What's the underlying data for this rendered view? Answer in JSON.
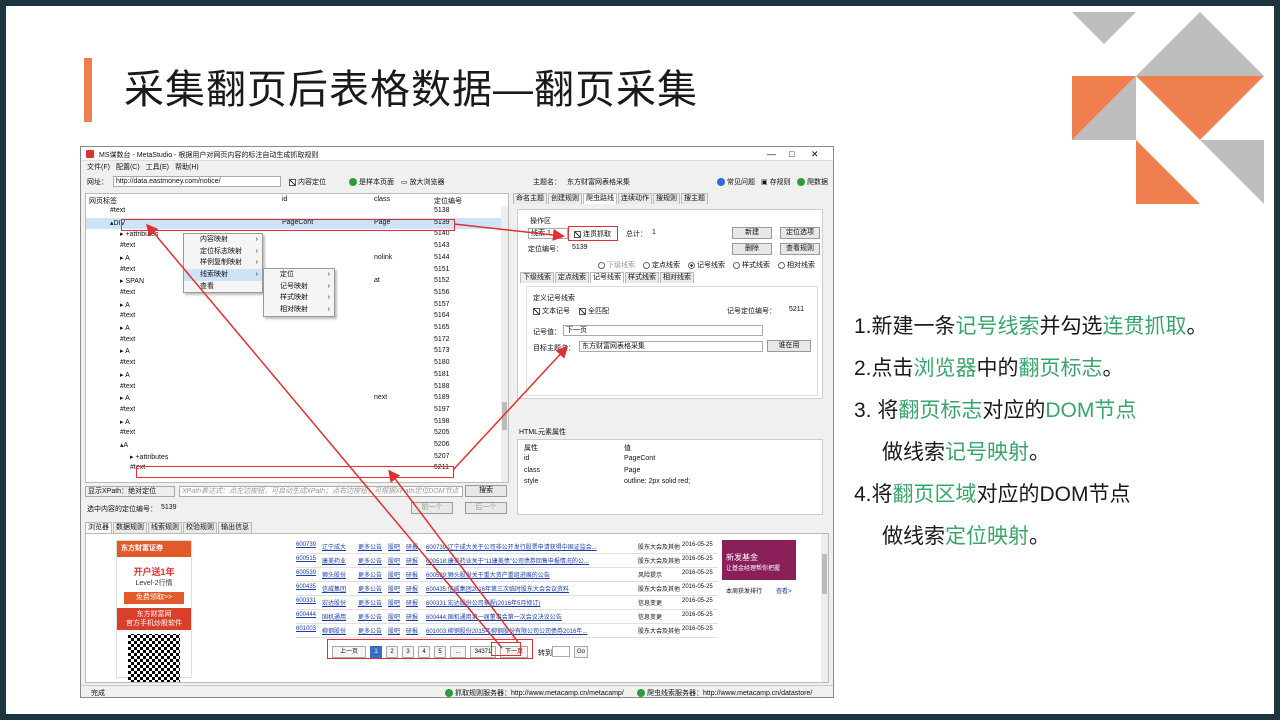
{
  "slide": {
    "title": "采集翻页后表格数据—翻页采集",
    "accent_color": "#ef7f4f",
    "highlight_color": "#3aa56b"
  },
  "notes": [
    [
      {
        "t": "1.新建一条"
      },
      {
        "t": "记号线索",
        "hl": true
      },
      {
        "t": "并勾选"
      },
      {
        "t": "连贯抓取",
        "hl": true
      },
      {
        "t": "。"
      }
    ],
    [
      {
        "t": "2.点击"
      },
      {
        "t": "浏览器",
        "hl": true
      },
      {
        "t": "中的"
      },
      {
        "t": "翻页标志",
        "hl": true
      },
      {
        "t": "。"
      }
    ],
    [
      {
        "t": "3. 将"
      },
      {
        "t": "翻页标志",
        "hl": true
      },
      {
        "t": "对应的"
      },
      {
        "t": "DOM节点",
        "hl": true
      }
    ],
    [
      {
        "t": "做线索"
      },
      {
        "t": "记号映射",
        "hl": true
      },
      {
        "t": "。"
      }
    ],
    [
      {
        "t": "4.将"
      },
      {
        "t": "翻页区域",
        "hl": true
      },
      {
        "t": "对应的DOM节点"
      }
    ],
    [
      {
        "t": "做线索"
      },
      {
        "t": "定位映射",
        "hl": true
      },
      {
        "t": "。"
      }
    ]
  ],
  "window": {
    "title": "MS谋数台 - MetaStudio - 根据用户对网页内容的标注自动生成抓取规则",
    "menu": [
      "文件(F)",
      "配置(C)",
      "工具(E)",
      "帮助(H)"
    ],
    "address_label": "网址：",
    "address_value": "http://data.eastmoney.com/notice/",
    "content_locate": "内容定位",
    "btn_sample": "是样本页面",
    "btn_zoom": "放大浏览器",
    "topic_label": "主题名：",
    "topic_value": "东方财富网表格采集",
    "faq": "常见问题",
    "save_rule": "存规则",
    "crawl_data": "爬数据",
    "tree_headers": [
      "网页标签",
      "id",
      "class",
      "定位编号"
    ],
    "tree_rows": [
      {
        "tag": "#text",
        "id": "",
        "cls": "",
        "num": "5138",
        "indent": 2
      },
      {
        "tag": "▴DIV",
        "id": "PageCont",
        "cls": "Page",
        "num": "5139",
        "indent": 2,
        "sel": true
      },
      {
        "tag": "▸ +attributes",
        "id": "",
        "cls": "",
        "num": "5140",
        "indent": 3
      },
      {
        "tag": "#text",
        "id": "",
        "cls": "",
        "num": "5143",
        "indent": 3
      },
      {
        "tag": "▸ A",
        "id": "",
        "cls": "nolink",
        "num": "5144",
        "indent": 3
      },
      {
        "tag": "#text",
        "id": "",
        "cls": "",
        "num": "5151",
        "indent": 3
      },
      {
        "tag": "▸ SPAN",
        "id": "",
        "cls": "at",
        "num": "5152",
        "indent": 3
      },
      {
        "tag": "#text",
        "id": "",
        "cls": "",
        "num": "5156",
        "indent": 3
      },
      {
        "tag": "▸ A",
        "id": "",
        "cls": "",
        "num": "5157",
        "indent": 3
      },
      {
        "tag": "#text",
        "id": "",
        "cls": "",
        "num": "5164",
        "indent": 3
      },
      {
        "tag": "▸ A",
        "id": "",
        "cls": "",
        "num": "5165",
        "indent": 3
      },
      {
        "tag": "#text",
        "id": "",
        "cls": "",
        "num": "5172",
        "indent": 3
      },
      {
        "tag": "▸ A",
        "id": "",
        "cls": "",
        "num": "5173",
        "indent": 3
      },
      {
        "tag": "#text",
        "id": "",
        "cls": "",
        "num": "5180",
        "indent": 3
      },
      {
        "tag": "▸ A",
        "id": "",
        "cls": "",
        "num": "5181",
        "indent": 3
      },
      {
        "tag": "#text",
        "id": "",
        "cls": "",
        "num": "5188",
        "indent": 3
      },
      {
        "tag": "▸ A",
        "id": "",
        "cls": "next",
        "num": "5189",
        "indent": 3
      },
      {
        "tag": "#text",
        "id": "",
        "cls": "",
        "num": "5197",
        "indent": 3
      },
      {
        "tag": "▸ A",
        "id": "",
        "cls": "",
        "num": "5198",
        "indent": 3
      },
      {
        "tag": "#text",
        "id": "",
        "cls": "",
        "num": "5205",
        "indent": 3
      },
      {
        "tag": "▴A",
        "id": "",
        "cls": "",
        "num": "5206",
        "indent": 3
      },
      {
        "tag": "▸ +attributes",
        "id": "",
        "cls": "",
        "num": "5207",
        "indent": 4
      },
      {
        "tag": "#text",
        "id": "",
        "cls": "",
        "num": "5211",
        "indent": 4
      }
    ],
    "ctx_menu1": [
      "内容映射",
      "定位标志映射",
      "样例复制映射",
      "线索映射",
      "查看"
    ],
    "ctx_menu2": [
      "定位",
      "记号映射",
      "样式映射",
      "相对映射"
    ],
    "xpath_label": "显示XPath：绝对定位",
    "xpath_placeholder": "XPath表达式：点左边按钮，可自动生成XPath；点右边按钮，可根据XPath定位DOM节点",
    "search": "搜索",
    "selected_label": "选中内容的定位编号：",
    "selected_value": "5139",
    "prev": "前一个",
    "next": "后一个",
    "right_tabs": [
      "命名主题",
      "创建规则",
      "爬虫路线",
      "连续动作",
      "搜规则",
      "搜主题"
    ],
    "op_area": "操作区",
    "clue_select": "线索 1",
    "continuous": "连贯抓取",
    "total_label": "总计：",
    "total_value": "1",
    "btn_new": "新建",
    "btn_locate_opt": "定位选项",
    "btn_delete": "删除",
    "btn_view_rule": "查看规则",
    "locate_num_label": "定位编号：",
    "locate_num_value": "5139",
    "radios": [
      "下级线索",
      "定点线索",
      "记号线索",
      "样式线索",
      "相对线索"
    ],
    "sub_tabs": [
      "下级线索",
      "定点线索",
      "记号线索",
      "样式线索",
      "相对线索"
    ],
    "def_mark": "定义记号线索",
    "text_mark": "文本记号",
    "full_match": "全匹配",
    "mark_locate_label": "记号定位编号：",
    "mark_locate_value": "5211",
    "mark_value_label": "记号值：",
    "mark_value": "下一页",
    "target_topic_label": "目标主题名：",
    "target_topic_value": "东方财富网表格采集",
    "btn_use": "谁在用",
    "html_attr": "HTML元素属性",
    "attr_headers": [
      "属性",
      "值"
    ],
    "attrs": [
      [
        "id",
        "PageCont"
      ],
      [
        "class",
        "Page"
      ],
      [
        "style",
        "outline: 2px solid red;"
      ]
    ],
    "bottom_tabs": [
      "浏览器",
      "数据规则",
      "线索规则",
      "校验规则",
      "输出信息"
    ],
    "status_left": "完成",
    "status_srv1": "抓取规则服务器：http://www.metacamp.cn/metacamp/",
    "status_srv2": "爬虫线索服务器：http://www.metacamp.cn/datastore/"
  },
  "browser": {
    "ad_brand": "东方财富证券",
    "ad_line1": "开户送1年",
    "ad_line2": "Level-2行情",
    "ad_btn": "免费领取>>",
    "ad_app": "东方财富网\n官方手机炒股软件",
    "right_ad_title": "新发基金",
    "right_ad_sub": "让基金经理帮你把握",
    "right_ad_rank": "本周获发排行",
    "right_ad_more": "查看>",
    "rows": [
      {
        "code": "600739",
        "name": "辽宁成大",
        "a": "更多公告",
        "b": "股吧",
        "c": "研报",
        "title": "600739:辽宁成大关于公司非公开发行股票申请获得中国证监会...",
        "type": "股东大会及其他",
        "date": "2016-05-25"
      },
      {
        "code": "600515",
        "name": "康美药业",
        "a": "更多公告",
        "b": "股吧",
        "c": "研报",
        "title": "600518:康美药业关于“11康美债”公司债券回售申报情况的公...",
        "type": "股东大会及其他",
        "date": "2016-05-25"
      },
      {
        "code": "600539",
        "name": "狮头股份",
        "a": "更多公告",
        "b": "股吧",
        "c": "研报",
        "title": "600539:狮头股份关于重大资产重组进展的公告",
        "type": "风险提示",
        "date": "2016-05-25"
      },
      {
        "code": "600435",
        "name": "信威集团",
        "a": "更多公告",
        "b": "股吧",
        "c": "研报",
        "title": "600435:信威集团2016年第三次临时股东大会会议资料",
        "type": "股东大会及其他",
        "date": "2016-05-25"
      },
      {
        "code": "600331",
        "name": "宏达股份",
        "a": "更多公告",
        "b": "股吧",
        "c": "研报",
        "title": "600331:宏达股份公司章程(2016年5月修订)",
        "type": "信息变更",
        "date": "2016-05-25"
      },
      {
        "code": "600444",
        "name": "国机通用",
        "a": "更多公告",
        "b": "股吧",
        "c": "研报",
        "title": "600444:国机通用第一届董事会第一次会议决议公告",
        "type": "信息变更",
        "date": "2016-05-25"
      },
      {
        "code": "601003",
        "name": "柳钢股份",
        "a": "更多公告",
        "b": "股吧",
        "c": "研报",
        "title": "601003:柳钢股份2015年柳钢股份有限公司公司债券2016年...",
        "type": "股东大会及其他",
        "date": "2016-05-25"
      }
    ],
    "pager": [
      "上一页",
      "1",
      "2",
      "3",
      "4",
      "5",
      "...",
      "34371",
      "下一页"
    ],
    "goto_label": "转到",
    "go": "Go"
  }
}
